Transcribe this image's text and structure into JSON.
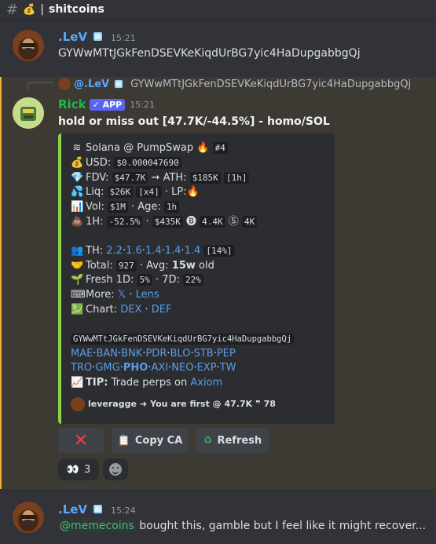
{
  "channel": {
    "icon": "money-bag",
    "name": "shitcoins"
  },
  "message1": {
    "author": ".LeV",
    "author_color": "#5aa7ff",
    "time": "15:21",
    "content": "GYWwMTtJGkFenDSEVKeKiqdUrBG7yic4HaDupgabbgQj"
  },
  "reply": {
    "author": "@.LeV",
    "content": "GYWwMTtJGkFenDSEVKeKiqdUrBG7yic4HaDupgabbgQj"
  },
  "message2": {
    "author": "Rick",
    "author_color": "#1fb84a",
    "badge": "✓ APP",
    "time": "15:21",
    "title": "hold or miss out [47.7K/-44.5%] - homo/SOL",
    "embed": {
      "accent": "#8bd24c",
      "header": "Solana @ PumpSwap",
      "rank": "#4",
      "usd_label": "USD:",
      "usd": "$0.000047690",
      "fdv_label": "FDV:",
      "fdv": "$47.7K",
      "ath_label": "ATH:",
      "ath": "$185K",
      "ath_time": "[1h]",
      "liq_label": "Liq:",
      "liq": "$26K",
      "liq_mult": "[x4]",
      "lp_label": "· LP:",
      "vol_label": "Vol:",
      "vol": "$1M",
      "age_label": "· Age:",
      "age": "1h",
      "h1_label": "1H:",
      "h1_change": "-52.5%",
      "h1_volume": "$435K",
      "h1_buys": "4.4K",
      "h1_sells": "4K",
      "th_label": "TH:",
      "th_values": [
        "2.2",
        "1.6",
        "1.4",
        "1.4",
        "1.4"
      ],
      "th_total": "[14%]",
      "total_label": "Total:",
      "total": "927",
      "avg_label": "· Avg:",
      "avg": "15w",
      "avg_suffix": "old",
      "fresh_label": "Fresh 1D:",
      "fresh_1d": "5%",
      "fresh_7d_label": "· 7D:",
      "fresh_7d": "22%",
      "more_label": "More:",
      "more_links": [
        "𝕏",
        "Lens"
      ],
      "chart_label": "Chart:",
      "chart_links": [
        "DEX",
        "DEF"
      ],
      "ca": "GYWwMTtJGkFenDSEVKeKiqdUrBG7yic4HaDupgabbgQj",
      "exchanges_row1": [
        "MAE",
        "BAN",
        "BNK",
        "PDR",
        "BLO",
        "STB",
        "PEP"
      ],
      "exchanges_row2": [
        "TRO",
        "GMG",
        "PHO",
        "AXI",
        "NEO",
        "EXP",
        "TW"
      ],
      "tip_label": "TIP:",
      "tip_text": "Trade perps on",
      "tip_link": "Axiom",
      "footer_user": "leveragge",
      "footer_text": "You are first @ 47.7K",
      "footer_count": "78"
    },
    "buttons": {
      "close": "✕",
      "copy": "Copy CA",
      "refresh": "Refresh"
    },
    "reactions": [
      {
        "emoji": "👀",
        "count": "3"
      }
    ]
  },
  "message3": {
    "author": ".LeV",
    "time": "15:24",
    "mention": "@memecoins",
    "content": " bought this, gamble but I feel like it might recover..."
  }
}
